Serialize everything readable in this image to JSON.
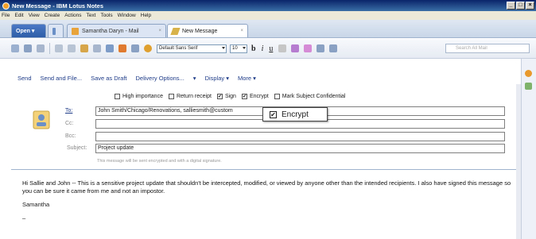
{
  "window": {
    "title": "New Message - IBM Lotus Notes",
    "min": "_",
    "max": "□",
    "close": "×"
  },
  "menu": [
    "File",
    "Edit",
    "View",
    "Create",
    "Actions",
    "Text",
    "Tools",
    "Window",
    "Help"
  ],
  "tabs": {
    "open": "Open ▾",
    "mail": "Samantha Daryn - Mail",
    "new_message": "New Message",
    "close_glyph": "×"
  },
  "toolbar": {
    "font": "Default Sans Serif",
    "size": "10",
    "bold": "b",
    "italic": "i",
    "underline": "u",
    "search_placeholder": "Search All Mail"
  },
  "actions": [
    "Send",
    "Send and File...",
    "Save as Draft",
    "Delivery Options...",
    "▾",
    "Display ▾",
    "More ▾"
  ],
  "options": [
    {
      "label": "High importance",
      "checked": false
    },
    {
      "label": "Return receipt",
      "checked": false
    },
    {
      "label": "Sign",
      "checked": true
    },
    {
      "label": "Encrypt",
      "checked": true
    },
    {
      "label": "Mark Subject Confidential",
      "checked": false
    }
  ],
  "fields": {
    "to_label": "To:",
    "to_value": "John Smith/Chicago/Renovations, salliesmith@custom",
    "cc_label": "Cc:",
    "cc_value": "",
    "bcc_label": "Bcc:",
    "bcc_value": "",
    "subject_label": "Subject:",
    "subject_value": "Project update"
  },
  "note": "This message will be sent encrypted and with a digital signature.",
  "body": "Hi Sallie and John -- This is a sensitive project update that shouldn't be intercepted, modified, or viewed by anyone other than the intended recipients. I also have signed this message so you can be sure it came from me and not an impostor.",
  "signature": "Samantha",
  "dash": "–",
  "popup": {
    "label": "Encrypt",
    "check": "✔"
  },
  "check_glyph": "✔",
  "colors": {
    "accent": "#2f5ea8",
    "link": "#1f3c88",
    "titlebar": "#0a246a"
  }
}
